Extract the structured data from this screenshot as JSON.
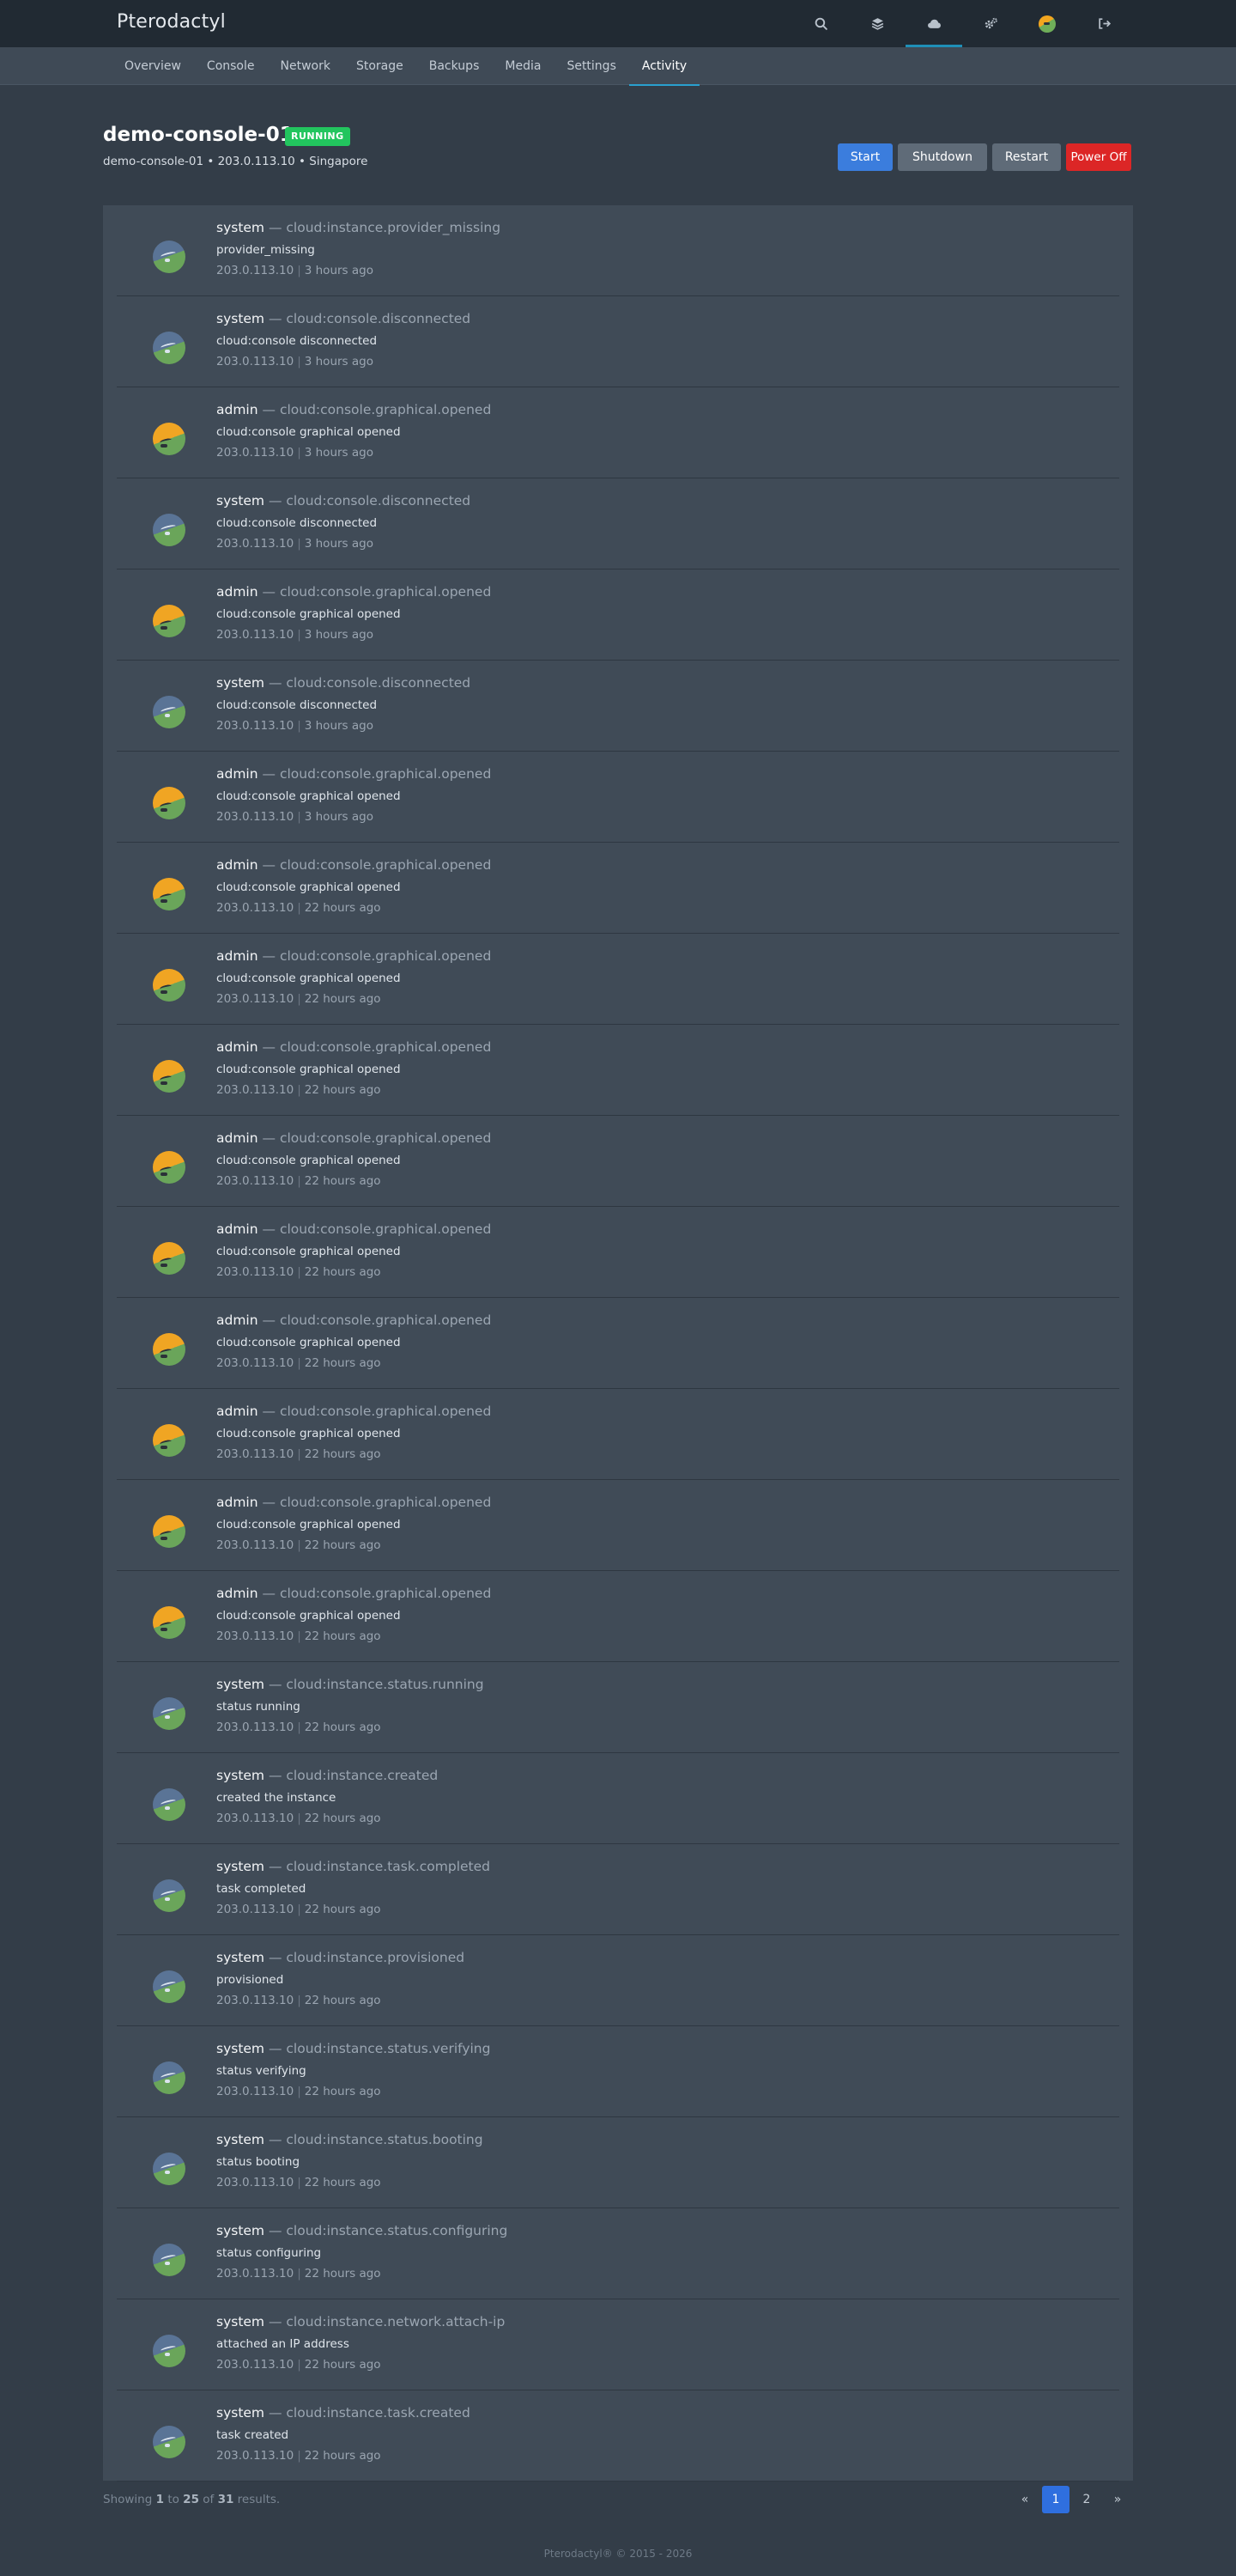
{
  "app": {
    "brand": "Pterodactyl"
  },
  "topnav": {
    "icons": [
      "search-icon",
      "layers-icon",
      "cloud-icon",
      "cogs-icon",
      "avatar",
      "logout-icon"
    ],
    "active": "cloud-icon"
  },
  "subnav": {
    "items": [
      {
        "label": "Overview"
      },
      {
        "label": "Console"
      },
      {
        "label": "Network"
      },
      {
        "label": "Storage"
      },
      {
        "label": "Backups"
      },
      {
        "label": "Media"
      },
      {
        "label": "Settings"
      },
      {
        "label": "Activity"
      }
    ],
    "active_index": 7
  },
  "server": {
    "name": "demo-console-01",
    "status": "RUNNING",
    "subtitle": "demo-console-01 • 203.0.113.10 • Singapore"
  },
  "power": {
    "start": "Start",
    "shutdown": "Shutdown",
    "restart": "Restart",
    "power_off": "Power Off"
  },
  "activity": [
    {
      "actor": "system",
      "event": "cloud:instance.provider_missing",
      "desc": "provider_missing",
      "ip": "203.0.113.10",
      "time": "3 hours ago"
    },
    {
      "actor": "system",
      "event": "cloud:console.disconnected",
      "desc": "cloud:console disconnected",
      "ip": "203.0.113.10",
      "time": "3 hours ago"
    },
    {
      "actor": "admin",
      "event": "cloud:console.graphical.opened",
      "desc": "cloud:console graphical opened",
      "ip": "203.0.113.10",
      "time": "3 hours ago"
    },
    {
      "actor": "system",
      "event": "cloud:console.disconnected",
      "desc": "cloud:console disconnected",
      "ip": "203.0.113.10",
      "time": "3 hours ago"
    },
    {
      "actor": "admin",
      "event": "cloud:console.graphical.opened",
      "desc": "cloud:console graphical opened",
      "ip": "203.0.113.10",
      "time": "3 hours ago"
    },
    {
      "actor": "system",
      "event": "cloud:console.disconnected",
      "desc": "cloud:console disconnected",
      "ip": "203.0.113.10",
      "time": "3 hours ago"
    },
    {
      "actor": "admin",
      "event": "cloud:console.graphical.opened",
      "desc": "cloud:console graphical opened",
      "ip": "203.0.113.10",
      "time": "3 hours ago"
    },
    {
      "actor": "admin",
      "event": "cloud:console.graphical.opened",
      "desc": "cloud:console graphical opened",
      "ip": "203.0.113.10",
      "time": "22 hours ago"
    },
    {
      "actor": "admin",
      "event": "cloud:console.graphical.opened",
      "desc": "cloud:console graphical opened",
      "ip": "203.0.113.10",
      "time": "22 hours ago"
    },
    {
      "actor": "admin",
      "event": "cloud:console.graphical.opened",
      "desc": "cloud:console graphical opened",
      "ip": "203.0.113.10",
      "time": "22 hours ago"
    },
    {
      "actor": "admin",
      "event": "cloud:console.graphical.opened",
      "desc": "cloud:console graphical opened",
      "ip": "203.0.113.10",
      "time": "22 hours ago"
    },
    {
      "actor": "admin",
      "event": "cloud:console.graphical.opened",
      "desc": "cloud:console graphical opened",
      "ip": "203.0.113.10",
      "time": "22 hours ago"
    },
    {
      "actor": "admin",
      "event": "cloud:console.graphical.opened",
      "desc": "cloud:console graphical opened",
      "ip": "203.0.113.10",
      "time": "22 hours ago"
    },
    {
      "actor": "admin",
      "event": "cloud:console.graphical.opened",
      "desc": "cloud:console graphical opened",
      "ip": "203.0.113.10",
      "time": "22 hours ago"
    },
    {
      "actor": "admin",
      "event": "cloud:console.graphical.opened",
      "desc": "cloud:console graphical opened",
      "ip": "203.0.113.10",
      "time": "22 hours ago"
    },
    {
      "actor": "admin",
      "event": "cloud:console.graphical.opened",
      "desc": "cloud:console graphical opened",
      "ip": "203.0.113.10",
      "time": "22 hours ago"
    },
    {
      "actor": "system",
      "event": "cloud:instance.status.running",
      "desc": "status running",
      "ip": "203.0.113.10",
      "time": "22 hours ago"
    },
    {
      "actor": "system",
      "event": "cloud:instance.created",
      "desc": "created the instance",
      "ip": "203.0.113.10",
      "time": "22 hours ago"
    },
    {
      "actor": "system",
      "event": "cloud:instance.task.completed",
      "desc": "task completed",
      "ip": "203.0.113.10",
      "time": "22 hours ago"
    },
    {
      "actor": "system",
      "event": "cloud:instance.provisioned",
      "desc": "provisioned",
      "ip": "203.0.113.10",
      "time": "22 hours ago"
    },
    {
      "actor": "system",
      "event": "cloud:instance.status.verifying",
      "desc": "status verifying",
      "ip": "203.0.113.10",
      "time": "22 hours ago"
    },
    {
      "actor": "system",
      "event": "cloud:instance.status.booting",
      "desc": "status booting",
      "ip": "203.0.113.10",
      "time": "22 hours ago"
    },
    {
      "actor": "system",
      "event": "cloud:instance.status.configuring",
      "desc": "status configuring",
      "ip": "203.0.113.10",
      "time": "22 hours ago"
    },
    {
      "actor": "system",
      "event": "cloud:instance.network.attach-ip",
      "desc": "attached an IP address",
      "ip": "203.0.113.10",
      "time": "22 hours ago"
    },
    {
      "actor": "system",
      "event": "cloud:instance.task.created",
      "desc": "task created",
      "ip": "203.0.113.10",
      "time": "22 hours ago"
    }
  ],
  "results": {
    "prefix": "Showing",
    "from": "1",
    "to_word": "to",
    "to": "25",
    "of_word": "of",
    "total": "31",
    "suffix": "results."
  },
  "pagination": {
    "prev": "«",
    "pages": [
      "1",
      "2"
    ],
    "current": "1",
    "next": "»"
  },
  "footer": "Pterodactyl® © 2015 - 2026",
  "colors": {
    "accent": "#2aa0cf",
    "status_running": "#22c55e",
    "start": "#3b7ddd",
    "power_off": "#dc2626"
  }
}
